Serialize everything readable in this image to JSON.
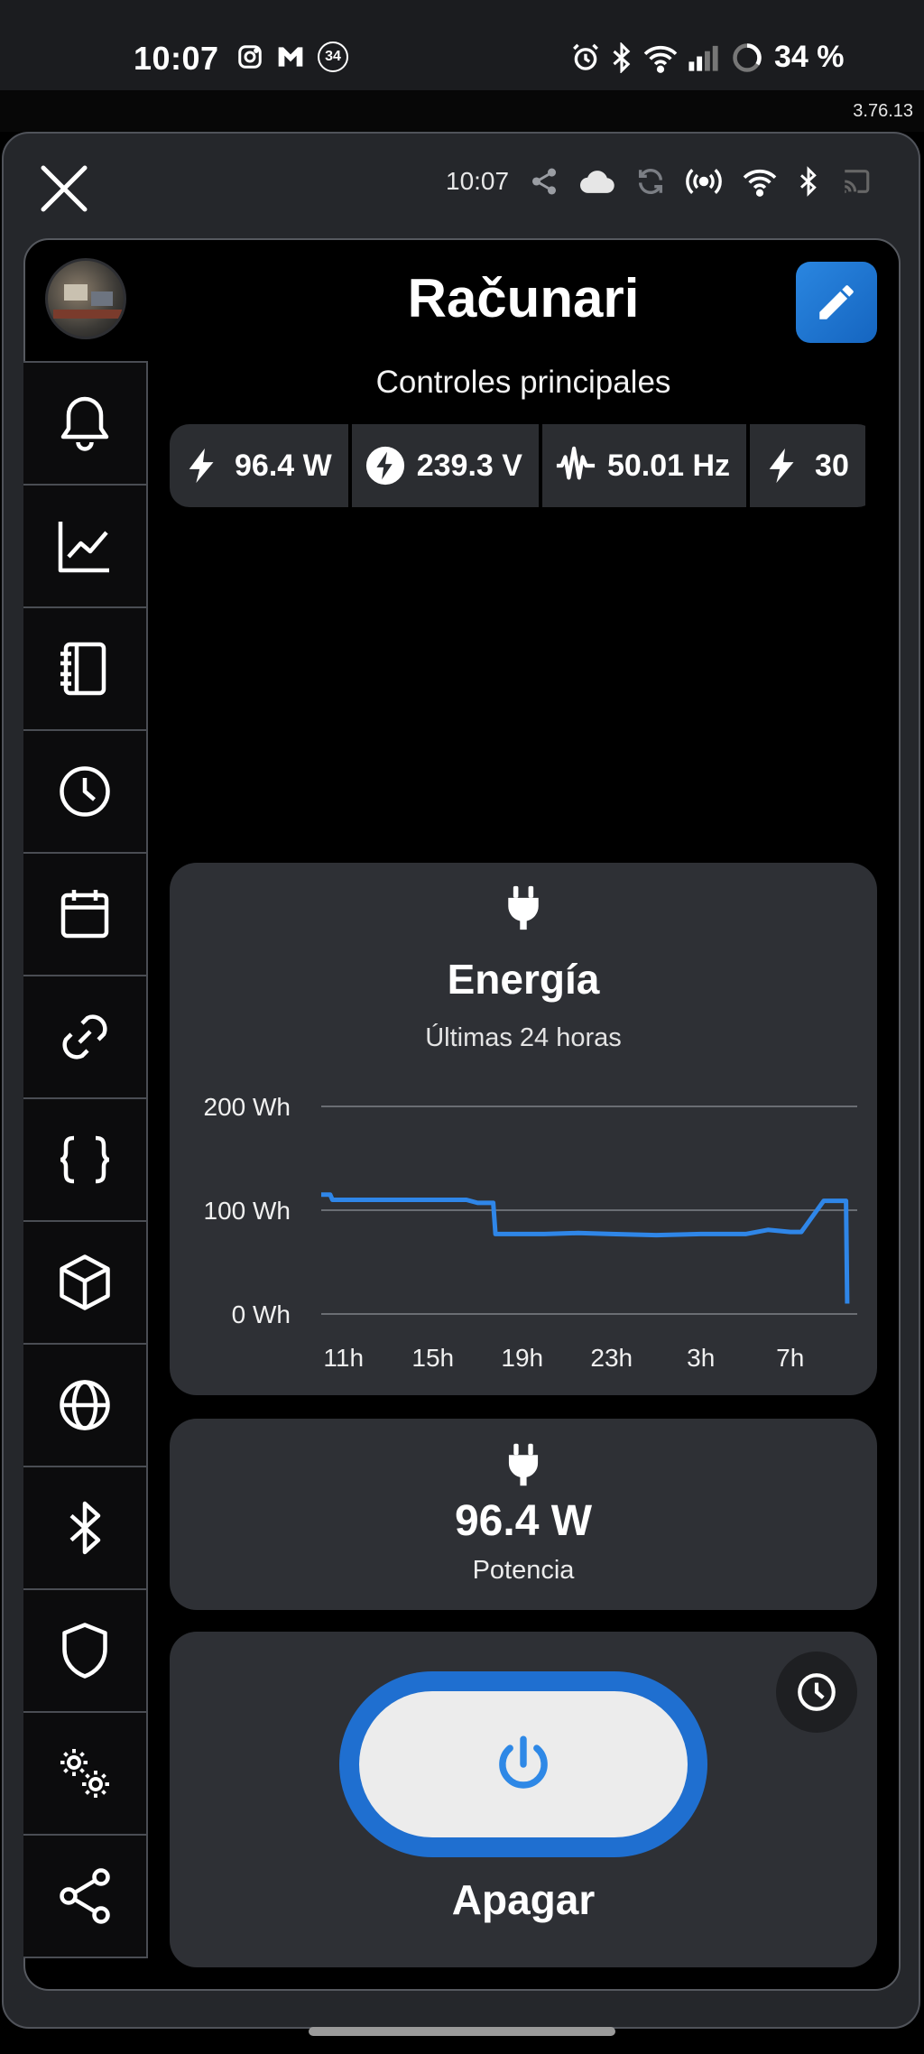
{
  "status_bar": {
    "time": "10:07",
    "notification_badge": "34",
    "battery": "34 %"
  },
  "app_version": "3.76.13",
  "toolbar": {
    "time": "10:07",
    "icons": [
      "share-icon",
      "cloud-icon",
      "sync-icon",
      "broadcast-icon",
      "wifi-icon",
      "bluetooth-icon",
      "cast-icon"
    ]
  },
  "sidebar": {
    "items": [
      {
        "icon": "bell-icon"
      },
      {
        "icon": "chart-icon"
      },
      {
        "icon": "notebook-icon"
      },
      {
        "icon": "clock-icon"
      },
      {
        "icon": "calendar-icon"
      },
      {
        "icon": "link-icon"
      },
      {
        "icon": "braces-icon"
      },
      {
        "icon": "cube-icon"
      },
      {
        "icon": "globe-icon"
      },
      {
        "icon": "bluetooth-icon"
      },
      {
        "icon": "shield-icon"
      },
      {
        "icon": "settings-icon"
      },
      {
        "icon": "share-icon"
      }
    ]
  },
  "device": {
    "title": "Računari",
    "subtitle": "Controles principales"
  },
  "chips": [
    {
      "icon": "bolt-icon",
      "value": "96.4 W"
    },
    {
      "icon": "bolt-circle-icon",
      "value": "239.3 V"
    },
    {
      "icon": "waveform-icon",
      "value": "50.01 Hz"
    },
    {
      "icon": "bolt-icon",
      "value": "30"
    }
  ],
  "energy_card": {
    "icon": "plug-icon",
    "title": "Energía",
    "subtitle": "Últimas 24 horas"
  },
  "chart_data": {
    "type": "line",
    "title": "Energía",
    "subtitle": "Últimas 24 horas",
    "ylim": [
      0,
      200
    ],
    "yticks": [
      "200 Wh",
      "100 Wh",
      "0 Wh"
    ],
    "xticks": [
      "11h",
      "15h",
      "19h",
      "23h",
      "3h",
      "7h"
    ],
    "grid": true,
    "color": "#2f86e8",
    "series": [
      {
        "x_hours": [
          10.0,
          10.4,
          10.5,
          11.5,
          13.5,
          15.0,
          16.5,
          17.0,
          17.7,
          17.8,
          19.0,
          20.0,
          21.5,
          23.0,
          1.0,
          3.0,
          5.0,
          6.0,
          7.0,
          7.5,
          8.5,
          9.5,
          9.55
        ],
        "values": [
          115,
          115,
          110,
          110,
          110,
          110,
          110,
          107,
          107,
          77,
          77,
          77,
          78,
          77,
          76,
          77,
          77,
          81,
          79,
          79,
          109,
          109,
          10
        ]
      }
    ]
  },
  "power_card": {
    "icon": "plug-icon",
    "value": "96.4 W",
    "label": "Potencia"
  },
  "switch_card": {
    "label": "Apagar",
    "state": "on",
    "accent": "#1f6fd0"
  }
}
